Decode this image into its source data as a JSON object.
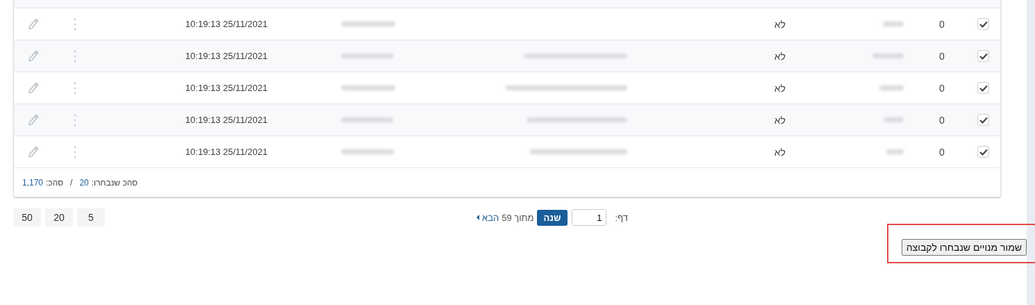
{
  "table": {
    "rows": [
      {
        "checked": true,
        "count": "0",
        "flag": "לא",
        "date": "10:19:13 25/11/2021"
      },
      {
        "checked": true,
        "count": "0",
        "flag": "לא",
        "date": "10:19:13 25/11/2021"
      },
      {
        "checked": true,
        "count": "0",
        "flag": "לא",
        "date": "10:19:13 25/11/2021"
      },
      {
        "checked": true,
        "count": "0",
        "flag": "לא",
        "date": "10:19:13 25/11/2021"
      },
      {
        "checked": true,
        "count": "0",
        "flag": "לא",
        "date": "10:19:13 25/11/2021"
      }
    ],
    "footer": {
      "selected_label": "סהכ שנבחרו:",
      "selected_value": "20",
      "separator": "/",
      "total_label": "סהכ:",
      "total_value": "1,170"
    }
  },
  "pagination": {
    "page_label": "דף:",
    "page_value": "1",
    "go_button": "שנה",
    "of_text": "מתוך 59",
    "next_link": "הבא",
    "page_sizes": [
      "5",
      "20",
      "50"
    ]
  },
  "save_button": {
    "label": "שמור מנויים שנבחרו לקבוצה",
    "highlighted": true
  }
}
